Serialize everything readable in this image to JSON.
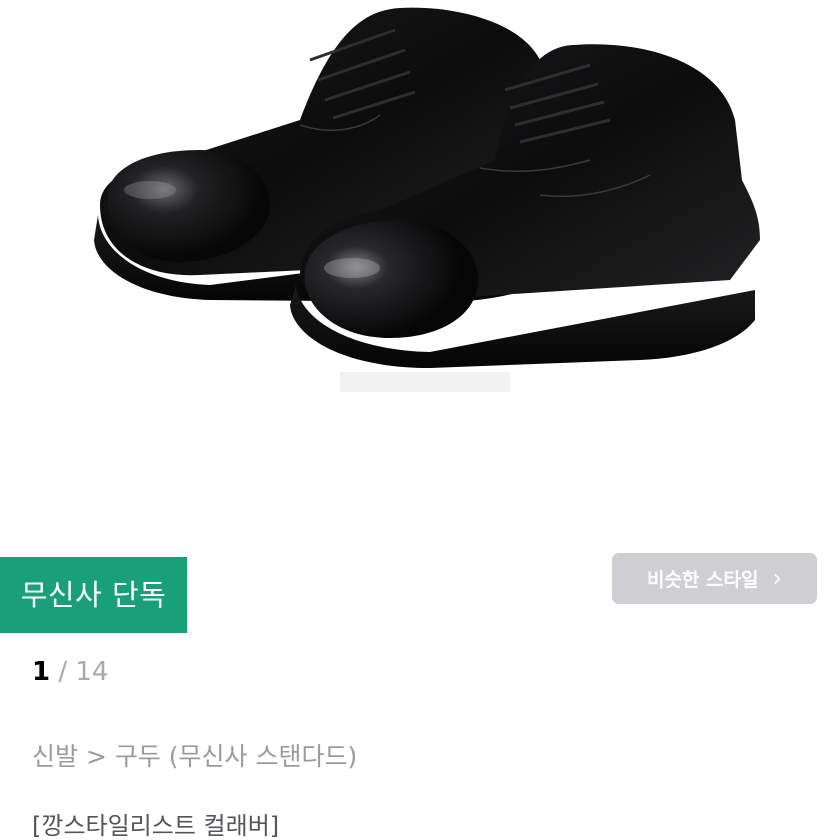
{
  "badge": {
    "label": "무신사 단독",
    "color": "#1aa079"
  },
  "similar_style": {
    "label": "비슷한 스타일",
    "icon": "chevron-right-icon"
  },
  "pager": {
    "current": "1",
    "separator": "/",
    "total": "14"
  },
  "breadcrumb": "신발 > 구두 (무신사 스탠다드)",
  "brand_line": "[깡스타일리스트 컬래버]"
}
